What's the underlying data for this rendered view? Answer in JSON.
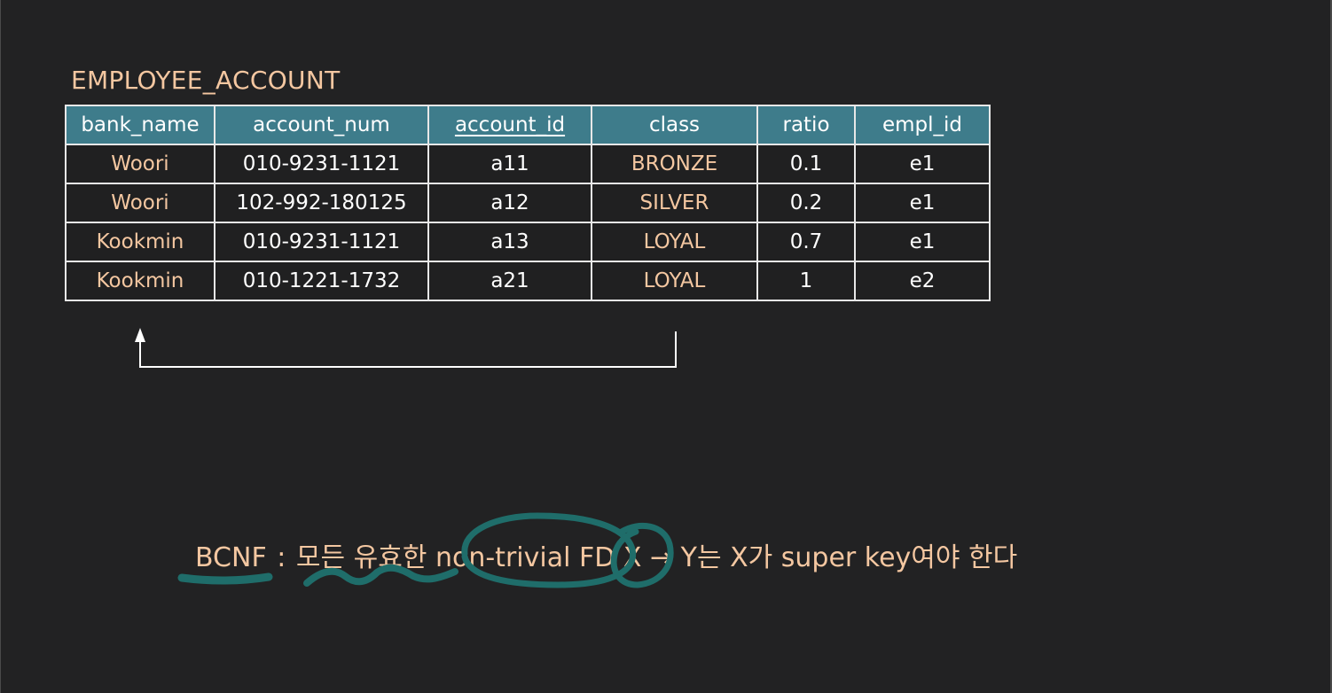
{
  "table": {
    "title": "EMPLOYEE_ACCOUNT",
    "columns": [
      "bank_name",
      "account_num",
      "account_id",
      "class",
      "ratio",
      "empl_id"
    ],
    "rows": [
      [
        "Woori",
        "010-9231-1121",
        "a11",
        "BRONZE",
        "0.1",
        "e1"
      ],
      [
        "Woori",
        "102-992-180125",
        "a12",
        "SILVER",
        "0.2",
        "e1"
      ],
      [
        "Kookmin",
        "010-9231-1121",
        "a13",
        "LOYAL",
        "0.7",
        "e1"
      ],
      [
        "Kookmin",
        "010-1221-1732",
        "a21",
        "LOYAL",
        "1",
        "e2"
      ]
    ]
  },
  "definition": {
    "term": "BCNF",
    "separator": ":",
    "text": "모든 유효한 non-trivial FD X → Y는 X가 super key여야 한다"
  },
  "colors": {
    "background": "#222223",
    "header_fill": "#3e7c8b",
    "accent_text": "#f4c7a1",
    "annotation_ink": "#1f6d6a",
    "border": "#e8e8e8"
  }
}
